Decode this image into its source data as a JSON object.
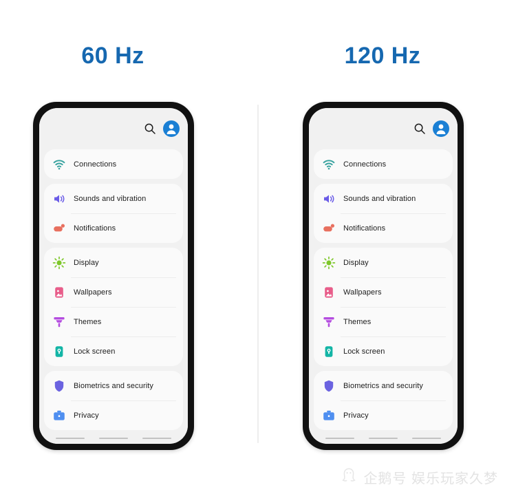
{
  "background_color": "#ffffff",
  "headings": {
    "left": "60 Hz",
    "right": "120 Hz",
    "color": "#1668b0"
  },
  "phone": {
    "bezel_color": "#111111",
    "screen_background": "#f1f1f1",
    "card_background": "#fafafa",
    "topbar": {
      "search_icon": "search-icon",
      "avatar_icon": "account-avatar-icon",
      "avatar_color": "#1a7fd4"
    },
    "settings_groups": [
      {
        "items": [
          {
            "label": "Connections",
            "icon": "wifi-icon",
            "color": "#3aa3a0"
          }
        ]
      },
      {
        "items": [
          {
            "label": "Sounds and vibration",
            "icon": "speaker-icon",
            "color": "#6b5ce7"
          },
          {
            "label": "Notifications",
            "icon": "notification-bubble-icon",
            "color": "#e8705f"
          }
        ]
      },
      {
        "items": [
          {
            "label": "Display",
            "icon": "brightness-sun-icon",
            "color": "#7ec72a"
          },
          {
            "label": "Wallpapers",
            "icon": "image-icon",
            "color": "#e85d8a"
          },
          {
            "label": "Themes",
            "icon": "paint-brush-icon",
            "color": "#b44ce0"
          },
          {
            "label": "Lock screen",
            "icon": "lock-icon",
            "color": "#13b5a6"
          }
        ]
      },
      {
        "items": [
          {
            "label": "Biometrics and security",
            "icon": "shield-icon",
            "color": "#6b63e0"
          },
          {
            "label": "Privacy",
            "icon": "briefcase-icon",
            "color": "#4f8ff0"
          }
        ]
      }
    ],
    "navbar_lines": 3
  },
  "divider": {
    "color": "#ededed"
  },
  "watermark": {
    "text": "企鹅号 娱乐玩家久梦",
    "logo": "penguin-logo-icon",
    "color": "#e3e3e3"
  }
}
